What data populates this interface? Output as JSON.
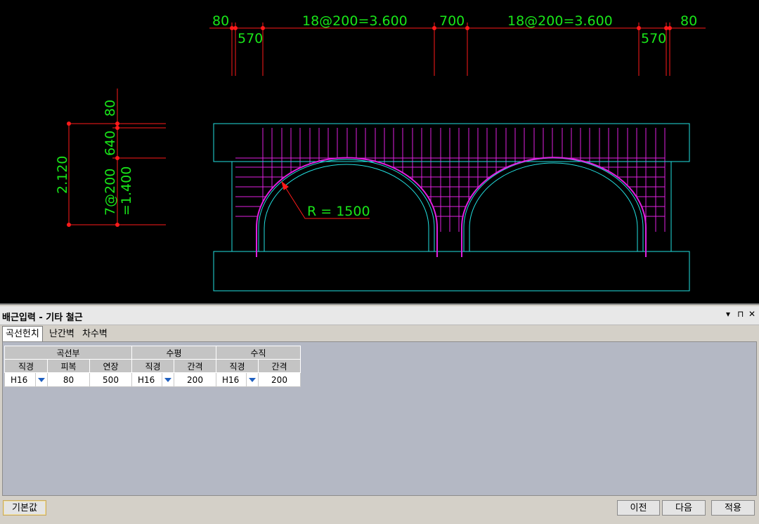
{
  "drawing": {
    "top_dims": [
      "80",
      "570",
      "18@200=3.600",
      "700",
      "18@200=3.600",
      "570",
      "80"
    ],
    "left_dims": [
      "80",
      "640",
      "2.120",
      "7@200",
      "=1.400"
    ],
    "radius_label": "R = 1500",
    "colors": {
      "dim": "#ff1a1a",
      "text": "#19e619",
      "outline": "#22e0e0",
      "rebar": "#e020e0"
    }
  },
  "panel": {
    "title": "배근입력 - 기타 철근",
    "controls": [
      "▾",
      "⊓",
      "✕"
    ],
    "tabs": [
      "곡선헌치",
      "난간벽",
      "차수벽"
    ],
    "table": {
      "groups": [
        "곡선부",
        "수평",
        "수직"
      ],
      "columns": [
        "직경",
        "피복",
        "연장",
        "직경",
        "간격",
        "직경",
        "간격"
      ],
      "row": [
        "H16",
        "80",
        "500",
        "H16",
        "200",
        "H16",
        "200"
      ]
    },
    "buttons": {
      "default": "기본값",
      "prev": "이전",
      "next": "다음",
      "apply": "적용"
    }
  }
}
